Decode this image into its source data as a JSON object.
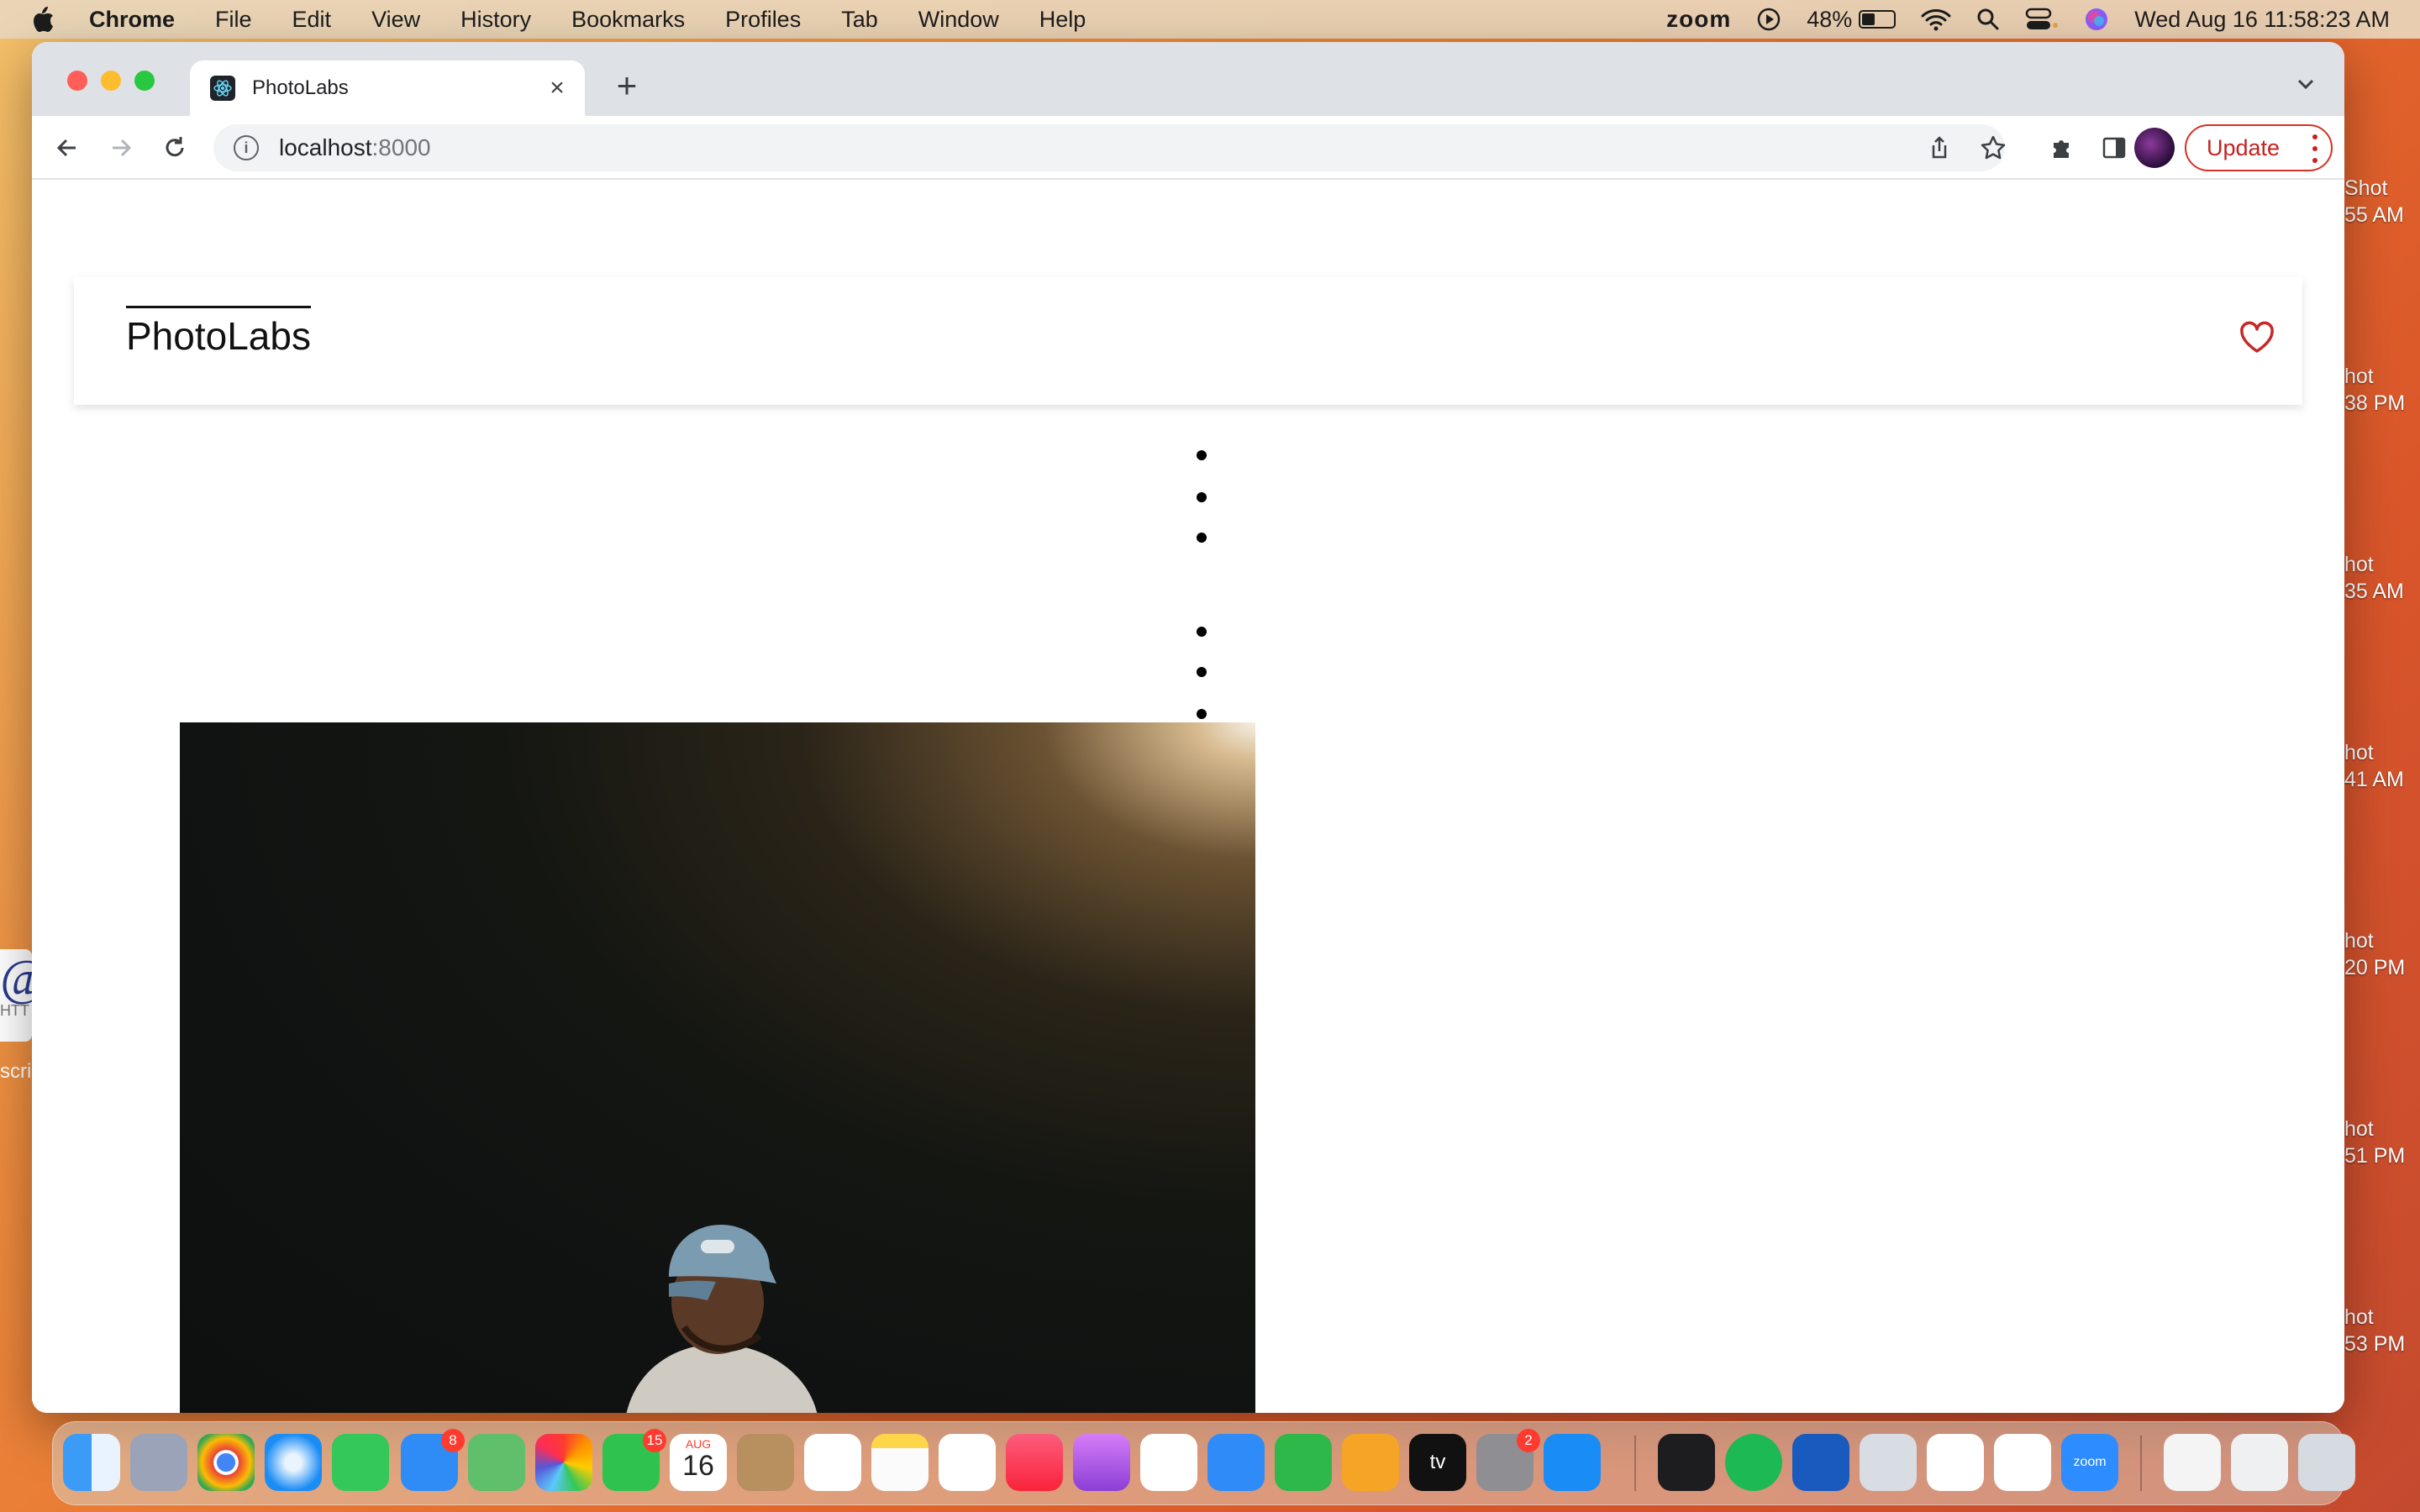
{
  "menubar": {
    "app": "Chrome",
    "items": [
      "File",
      "Edit",
      "View",
      "History",
      "Bookmarks",
      "Profiles",
      "Tab",
      "Window",
      "Help"
    ],
    "zoom": "zoom",
    "battery": "48%",
    "battery_level": 0.48,
    "datetime": "Wed Aug 16  11:58:23 AM"
  },
  "browser": {
    "tab_title": "PhotoLabs",
    "url_host": "localhost",
    "url_port": ":8000",
    "update_label": "Update"
  },
  "page": {
    "logo": "PhotoLabs",
    "bullet_groups": [
      [
        1,
        2,
        3
      ],
      [
        4,
        5,
        6
      ]
    ]
  },
  "desktop": {
    "side_labels": [
      [
        "Shot",
        "55 AM"
      ],
      [
        "hot",
        "38 PM"
      ],
      [
        "hot",
        "35 AM"
      ],
      [
        "hot",
        "41 AM"
      ],
      [
        "hot",
        "20 PM"
      ],
      [
        "hot",
        "51 PM"
      ],
      [
        "hot",
        "53 PM"
      ]
    ],
    "peek_left": [
      "HTT",
      "scri"
    ]
  },
  "dock": {
    "badges": {
      "mail": "8",
      "facetime": "15",
      "settings": "2"
    },
    "calendar_month": "AUG",
    "calendar_day": "16",
    "appletv_label": "tv",
    "zoom_label": "zoom"
  }
}
